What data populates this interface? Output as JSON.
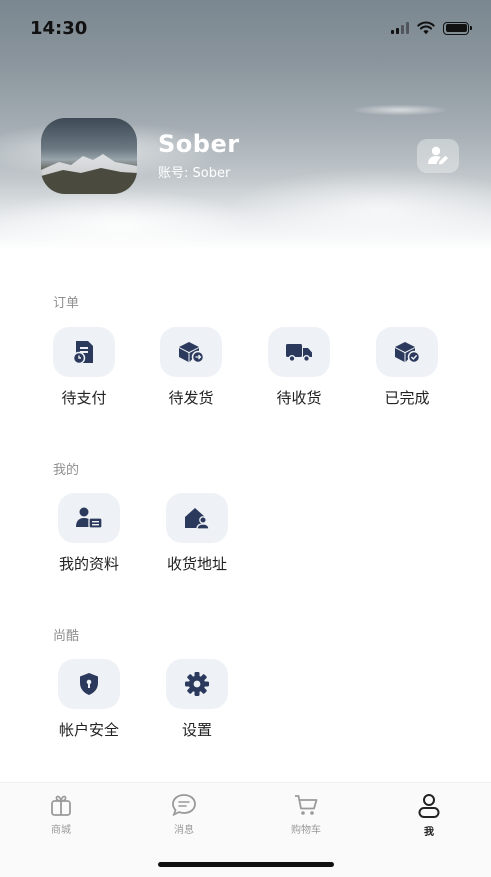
{
  "status_bar": {
    "time": "14:30"
  },
  "profile": {
    "name": "Sober",
    "account": "账号: Sober"
  },
  "sections": {
    "orders": {
      "title": "订单",
      "items": [
        {
          "label": "待支付",
          "icon": "pending-payment-icon"
        },
        {
          "label": "待发货",
          "icon": "pending-shipment-icon"
        },
        {
          "label": "待收货",
          "icon": "delivery-truck-icon"
        },
        {
          "label": "已完成",
          "icon": "completed-box-icon"
        }
      ]
    },
    "mine": {
      "title": "我的",
      "items": [
        {
          "label": "我的资料",
          "icon": "profile-card-icon"
        },
        {
          "label": "收货地址",
          "icon": "home-address-icon"
        }
      ]
    },
    "shangku": {
      "title": "尚酷",
      "items": [
        {
          "label": "帐户安全",
          "icon": "shield-lock-icon"
        },
        {
          "label": "设置",
          "icon": "gear-icon"
        }
      ]
    }
  },
  "tab_bar": {
    "active": "我",
    "items": [
      {
        "label": "商城",
        "icon": "gift-icon"
      },
      {
        "label": "消息",
        "icon": "chat-icon"
      },
      {
        "label": "购物车",
        "icon": "cart-icon"
      },
      {
        "label": "我",
        "icon": "user-icon"
      }
    ]
  },
  "colors": {
    "accent": "#2b3a5c",
    "icon_bg": "#eef1f6",
    "muted_text": "#8f8f8f"
  }
}
